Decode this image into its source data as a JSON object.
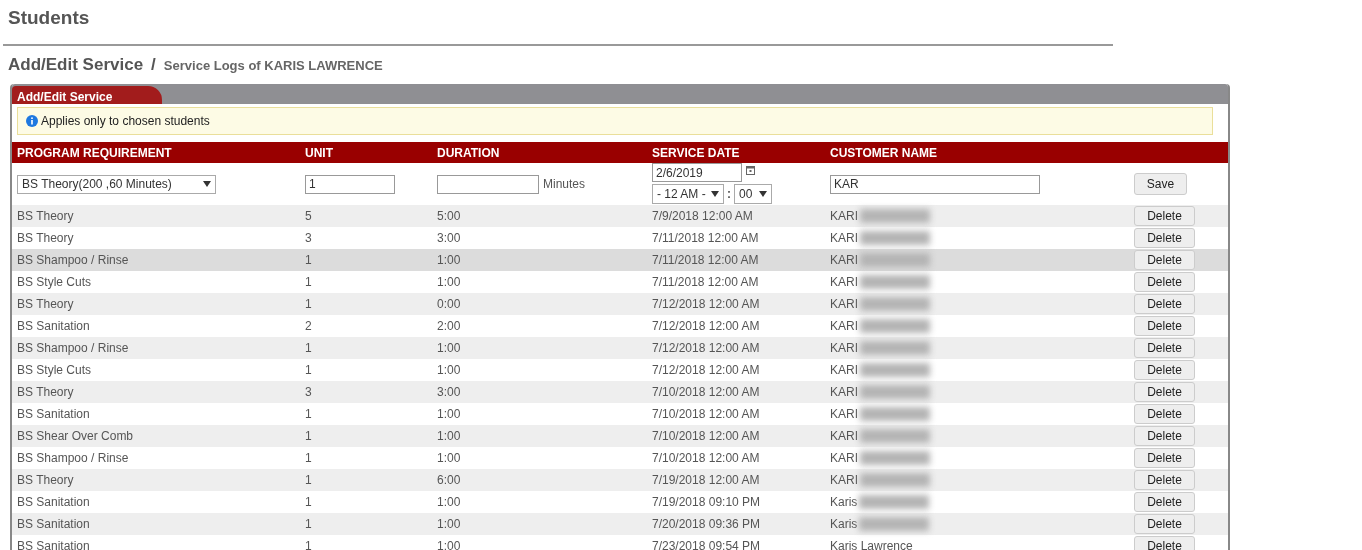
{
  "page_title": "Students",
  "breadcrumb": {
    "title": "Add/Edit Service",
    "separator": "/",
    "subtitle": "Service Logs of KARIS LAWRENCE"
  },
  "panel": {
    "tab": "Add/Edit Service",
    "notice": "Applies only to chosen students"
  },
  "table": {
    "columns": [
      "PROGRAM REQUIREMENT",
      "UNIT",
      "DURATION",
      "SERVICE DATE",
      "CUSTOMER NAME"
    ],
    "form": {
      "program": "BS Theory(200 ,60 Minutes)",
      "unit": "1",
      "duration_unit": "Minutes",
      "date": "2/6/2019",
      "hour": "- 12 AM -",
      "time_separator": ":",
      "minute": "00",
      "customer": "KAR",
      "button": "Save"
    },
    "rows": [
      {
        "program": "BS Theory",
        "unit": "5",
        "duration": "5:00",
        "date": "7/9/2018 12:00 AM",
        "customer": "KARI",
        "redacted": true,
        "highlighted": false,
        "action": "Delete"
      },
      {
        "program": "BS Theory",
        "unit": "3",
        "duration": "3:00",
        "date": "7/11/2018 12:00 AM",
        "customer": "KARI",
        "redacted": true,
        "highlighted": false,
        "action": "Delete"
      },
      {
        "program": "BS Shampoo / Rinse",
        "unit": "1",
        "duration": "1:00",
        "date": "7/11/2018 12:00 AM",
        "customer": "KARI",
        "redacted": true,
        "highlighted": true,
        "action": "Delete"
      },
      {
        "program": "BS Style Cuts",
        "unit": "1",
        "duration": "1:00",
        "date": "7/11/2018 12:00 AM",
        "customer": "KARI",
        "redacted": true,
        "highlighted": false,
        "action": "Delete"
      },
      {
        "program": "BS Theory",
        "unit": "1",
        "duration": "0:00",
        "date": "7/12/2018 12:00 AM",
        "customer": "KARI",
        "redacted": true,
        "highlighted": false,
        "action": "Delete"
      },
      {
        "program": "BS Sanitation",
        "unit": "2",
        "duration": "2:00",
        "date": "7/12/2018 12:00 AM",
        "customer": "KARI",
        "redacted": true,
        "highlighted": false,
        "action": "Delete"
      },
      {
        "program": "BS Shampoo / Rinse",
        "unit": "1",
        "duration": "1:00",
        "date": "7/12/2018 12:00 AM",
        "customer": "KARI",
        "redacted": true,
        "highlighted": false,
        "action": "Delete"
      },
      {
        "program": "BS Style Cuts",
        "unit": "1",
        "duration": "1:00",
        "date": "7/12/2018 12:00 AM",
        "customer": "KARI",
        "redacted": true,
        "highlighted": false,
        "action": "Delete"
      },
      {
        "program": "BS Theory",
        "unit": "3",
        "duration": "3:00",
        "date": "7/10/2018 12:00 AM",
        "customer": "KARI",
        "redacted": true,
        "highlighted": false,
        "action": "Delete"
      },
      {
        "program": "BS Sanitation",
        "unit": "1",
        "duration": "1:00",
        "date": "7/10/2018 12:00 AM",
        "customer": "KARI",
        "redacted": true,
        "highlighted": false,
        "action": "Delete"
      },
      {
        "program": "BS Shear Over Comb",
        "unit": "1",
        "duration": "1:00",
        "date": "7/10/2018 12:00 AM",
        "customer": "KARI",
        "redacted": true,
        "highlighted": false,
        "action": "Delete"
      },
      {
        "program": "BS Shampoo / Rinse",
        "unit": "1",
        "duration": "1:00",
        "date": "7/10/2018 12:00 AM",
        "customer": "KARI",
        "redacted": true,
        "highlighted": false,
        "action": "Delete"
      },
      {
        "program": "BS Theory",
        "unit": "1",
        "duration": "6:00",
        "date": "7/19/2018 12:00 AM",
        "customer": "KARI",
        "redacted": true,
        "highlighted": false,
        "action": "Delete"
      },
      {
        "program": "BS Sanitation",
        "unit": "1",
        "duration": "1:00",
        "date": "7/19/2018 09:10 PM",
        "customer": "Karis",
        "redacted": true,
        "highlighted": false,
        "action": "Delete"
      },
      {
        "program": "BS Sanitation",
        "unit": "1",
        "duration": "1:00",
        "date": "7/20/2018 09:36 PM",
        "customer": "Karis",
        "redacted": true,
        "highlighted": false,
        "action": "Delete"
      },
      {
        "program": "BS Sanitation",
        "unit": "1",
        "duration": "1:00",
        "date": "7/23/2018 09:54 PM",
        "customer": "Karis Lawrence",
        "redacted": false,
        "highlighted": false,
        "action": "Delete"
      }
    ]
  }
}
